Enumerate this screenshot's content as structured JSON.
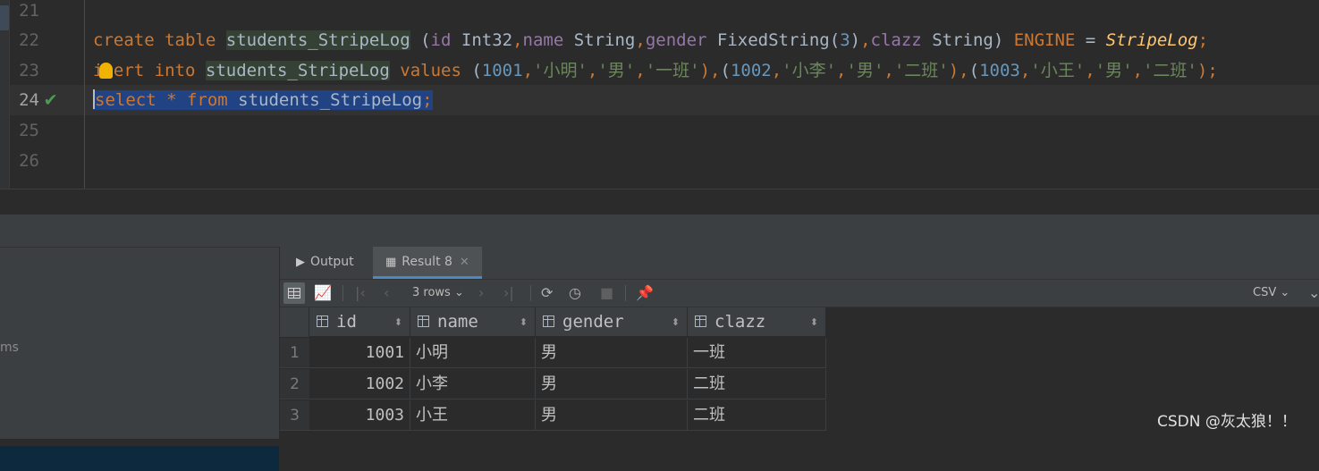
{
  "editor": {
    "line_numbers": [
      "21",
      "22",
      "23",
      "24",
      "25",
      "26"
    ],
    "line22": {
      "create": "create",
      "table": "table",
      "tbl": "students_StripeLog",
      "p1": " (",
      "c_id": "id",
      "t_id": " Int32",
      "comma1": ",",
      "c_name": "name",
      "t_name": " String",
      "comma2": ",",
      "c_gender": "gender",
      "t_gender": " FixedString(",
      "n3": "3",
      "p2": ")",
      "comma3": ",",
      "c_clazz": "clazz",
      "t_clazz": " String) ",
      "engine": "ENGINE",
      "eq": " = ",
      "engine_name": "StripeLog",
      "semi": ";"
    },
    "line23": {
      "i": "i",
      "sert": "sert",
      "into": "into",
      "tbl": "students_StripeLog",
      "values": "values",
      "o1": "(",
      "v1": "1001",
      "s1a": "'小明'",
      "s1b": "'男'",
      "s1c": "'一班'",
      "c1": "),",
      "o2": "(",
      "v2": "1002",
      "s2a": "'小李'",
      "s2b": "'男'",
      "s2c": "'二班'",
      "c2": "),",
      "o3": "(",
      "v3": "1003",
      "s3a": "'小王'",
      "s3b": "'男'",
      "s3c": "'二班'",
      "c3": ");"
    },
    "line24": {
      "select": "select",
      "star": " * ",
      "from": "from",
      "tbl": " students_StripeLog",
      "semi": ";"
    }
  },
  "left_panel": {
    "partial_text": "ms"
  },
  "tabs": [
    {
      "label": "Output",
      "icon": "console-icon"
    },
    {
      "label": "Result 8",
      "icon": "table-icon",
      "active": true
    }
  ],
  "toolbar": {
    "rows_label": "3 rows",
    "export_format": "CSV"
  },
  "result": {
    "columns": [
      "id",
      "name",
      "gender",
      "clazz"
    ],
    "rows": [
      {
        "n": "1",
        "id": "1001",
        "name": "小明",
        "gender": "男",
        "clazz": "一班"
      },
      {
        "n": "2",
        "id": "1002",
        "name": "小李",
        "gender": "男",
        "clazz": "二班"
      },
      {
        "n": "3",
        "id": "1003",
        "name": "小王",
        "gender": "男",
        "clazz": "二班"
      }
    ]
  },
  "watermark": "CSDN @灰太狼！！"
}
